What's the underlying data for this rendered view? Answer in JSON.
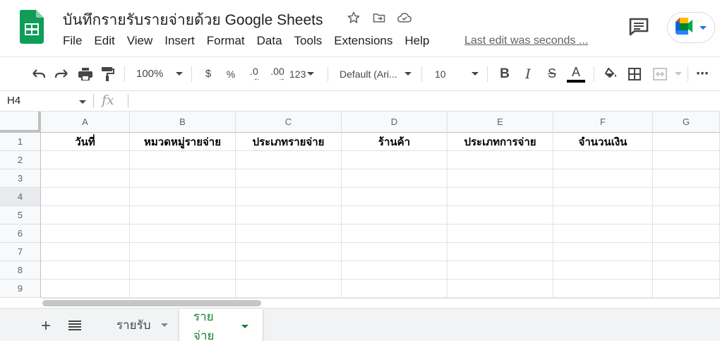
{
  "document": {
    "title": "บันทึกรายรับรายจ่ายด้วย Google Sheets",
    "last_edit": "Last edit was seconds ..."
  },
  "menu": [
    "File",
    "Edit",
    "View",
    "Insert",
    "Format",
    "Data",
    "Tools",
    "Extensions",
    "Help"
  ],
  "title_icons": [
    "star-icon",
    "move-folder-icon",
    "cloud-saved-icon"
  ],
  "toolbar": {
    "zoom": "100%",
    "currency": "$",
    "percent": "%",
    "decrease_decimal": ".0",
    "increase_decimal": ".00",
    "more_formats": "123",
    "font_family": "Default (Ari...",
    "font_size": "10",
    "bold": "B",
    "italic": "I",
    "strikethrough": "S",
    "text_color_label": "A",
    "text_color": "#000000",
    "more": "⋮"
  },
  "formula_bar": {
    "name_box": "H4",
    "fx_label": "fx",
    "formula": ""
  },
  "columns": [
    "A",
    "B",
    "C",
    "D",
    "E",
    "F",
    "G"
  ],
  "rows": [
    "1",
    "2",
    "3",
    "4",
    "5",
    "6",
    "7",
    "8",
    "9"
  ],
  "selected_row": "4",
  "header_row": [
    "วันที่",
    "หมวดหมู่รายจ่าย",
    "ประเภทรายจ่าย",
    "ร้านค้า",
    "ประเภทการจ่าย",
    "จำนวนเงิน",
    ""
  ],
  "sheet_tabs": [
    {
      "label": "รายรับ",
      "active": false
    },
    {
      "label": "รายจ่าย",
      "active": true
    }
  ],
  "colors": {
    "sheets_green": "#188038",
    "logo_green": "#0F9D58",
    "header_bg": "#f8f9fa"
  }
}
